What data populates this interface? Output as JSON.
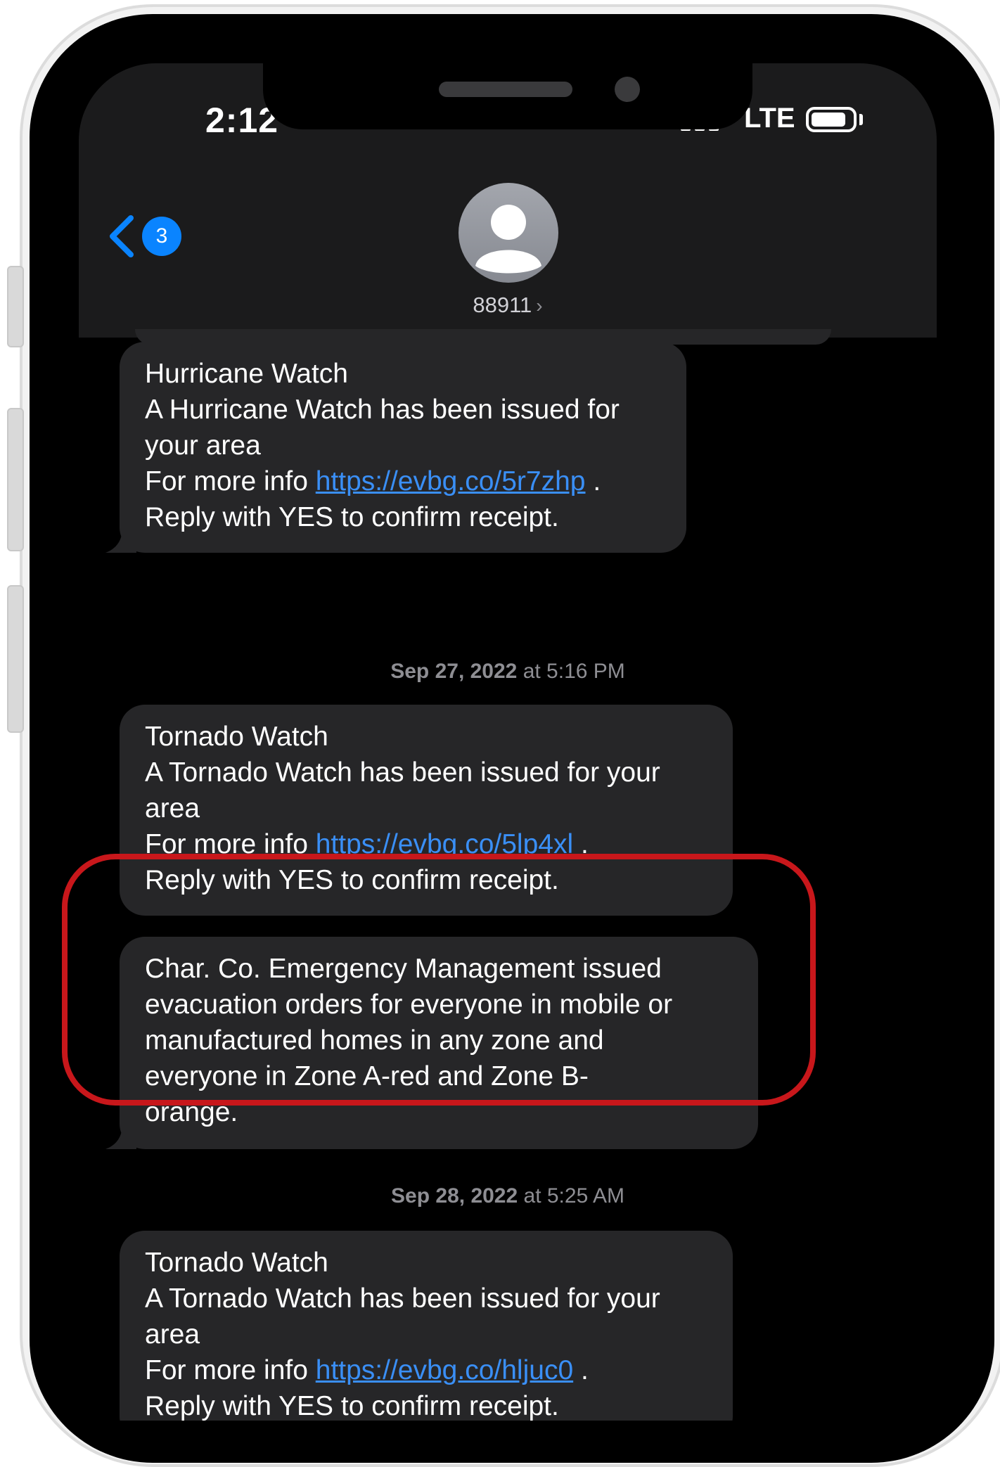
{
  "status_bar": {
    "time": "2:12",
    "network": "LTE"
  },
  "nav": {
    "back_badge": "3",
    "contact": "88911",
    "contact_chevron": "›"
  },
  "messages": [
    {
      "lines": [
        "Hurricane Watch",
        "A Hurricane Watch has been issued for",
        "your area"
      ],
      "info_prefix": "For more info ",
      "link": "https://evbg.co/5r7zhp",
      "info_suffix": " .",
      "reply": "Reply with YES to confirm receipt."
    },
    {
      "stamp_date": "Sep 27, 2022",
      "stamp_at": " at 5:16 PM"
    },
    {
      "lines": [
        "Tornado Watch",
        "A Tornado Watch has been issued for your",
        "area"
      ],
      "info_prefix": "For more info ",
      "link": "https://evbg.co/5lp4xl",
      "info_suffix": " .",
      "reply": "Reply with YES to confirm receipt."
    },
    {
      "lines": [
        "Char. Co. Emergency Management issued",
        "evacuation orders for everyone in mobile or",
        "manufactured homes in any zone and",
        "everyone in Zone A-red and Zone B-",
        "orange."
      ]
    },
    {
      "stamp_date": "Sep 28, 2022",
      "stamp_at": " at 5:25 AM"
    },
    {
      "lines": [
        "Tornado Watch",
        "A Tornado Watch has been issued for your",
        "area"
      ],
      "info_prefix": "For more info ",
      "link": "https://evbg.co/hljuc0",
      "info_suffix": " .",
      "reply": "Reply with YES to confirm receipt."
    }
  ],
  "colors": {
    "bubble": "#262628",
    "link": "#3a8ff6",
    "highlight": "#c8171b",
    "badge": "#0a84ff"
  }
}
